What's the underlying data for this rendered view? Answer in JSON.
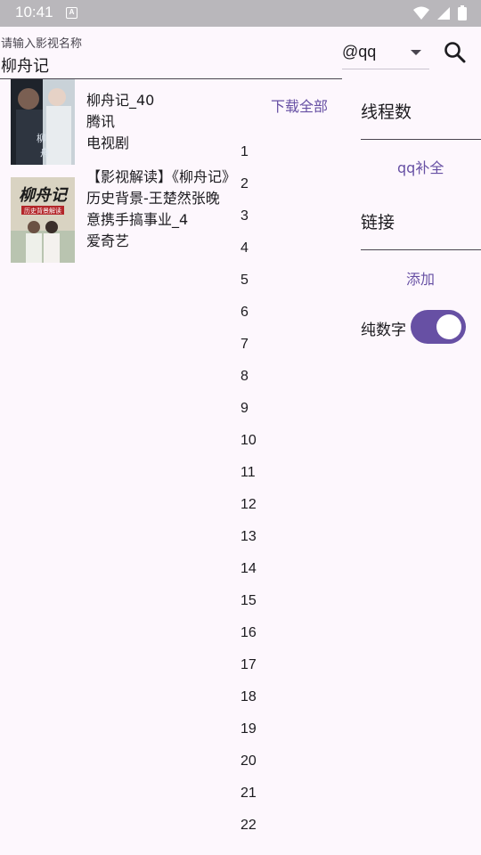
{
  "status_bar": {
    "time": "10:41",
    "notification_glyph": "A"
  },
  "search": {
    "hint": "请输入影视名称",
    "value": "柳舟记"
  },
  "source": {
    "selected": "@qq"
  },
  "results": [
    {
      "title": "柳舟记_40",
      "platform": "腾讯",
      "category": "电视剧"
    },
    {
      "description": "【影视解读】《柳舟记》历史背景-王楚然张晚意携手搞事业_4",
      "platform": "爱奇艺",
      "poster_text": "柳舟记",
      "poster_subtitle": "历史背景解读"
    }
  ],
  "download_all_label": "下载全部",
  "episode_numbers": [
    "1",
    "2",
    "3",
    "4",
    "5",
    "6",
    "7",
    "8",
    "9",
    "10",
    "11",
    "12",
    "13",
    "14",
    "15",
    "16",
    "17",
    "18",
    "19",
    "20",
    "21",
    "22"
  ],
  "side_panel": {
    "threads_label": "线程数",
    "qq_complete_label": "qq补全",
    "link_label": "链接",
    "add_label": "添加",
    "numeric_only_label": "纯数字",
    "numeric_only_on": true
  },
  "colors": {
    "accent": "#6750a4",
    "background": "#fdf7fd",
    "status_bar": "#b9b7bb"
  }
}
